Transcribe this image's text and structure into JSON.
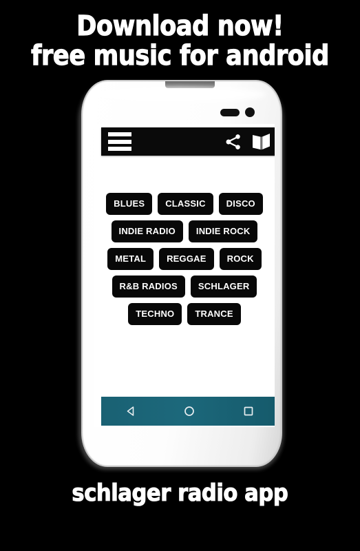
{
  "promo": {
    "background_color": "#000000",
    "headline": {
      "line1": "Download now!",
      "line2": "free music for android"
    },
    "caption": "schlager radio app"
  },
  "phone": {
    "hardware": {
      "earpiece_label": "earpiece-speaker",
      "camera_label": "front-camera"
    },
    "screen": {
      "appbar": {
        "background_color": "#0a0a0a",
        "menu_icon": "hamburger-menu-icon",
        "share_icon": "share-icon",
        "book_icon": "open-book-icon"
      },
      "genres": {
        "rows": [
          [
            "BLUES",
            "CLASSIC",
            "DISCO"
          ],
          [
            "INDIE RADIO",
            "INDIE ROCK"
          ],
          [
            "METAL",
            "REGGAE",
            "ROCK"
          ],
          [
            "R&B RADIOS",
            "SCHLAGER"
          ],
          [
            "TECHNO",
            "TRANCE"
          ]
        ],
        "button_background": "#080808",
        "button_text_color": "#ffffff"
      },
      "navbar": {
        "background_color": "#1c687b",
        "back_icon": "back-triangle-icon",
        "home_icon": "home-circle-icon",
        "recents_icon": "recents-square-icon"
      }
    }
  }
}
